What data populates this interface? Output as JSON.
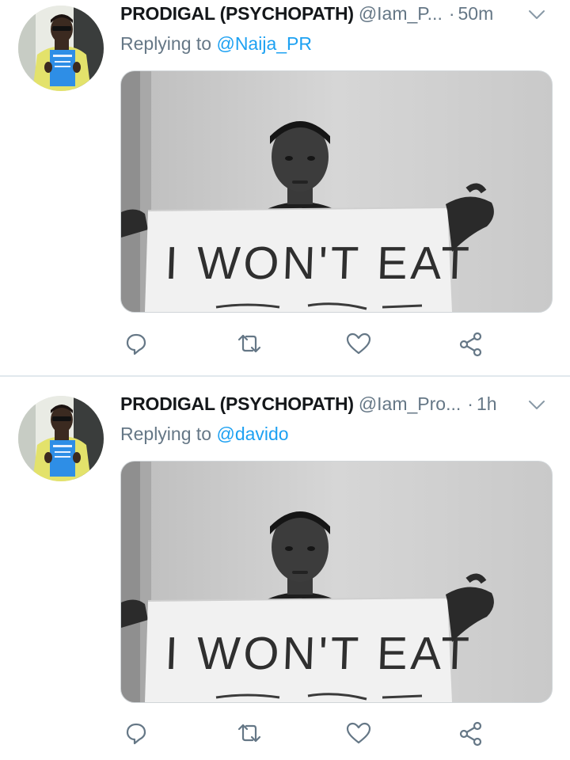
{
  "tweets": [
    {
      "display_name": "PRODIGAL (PSYCHOPATH)",
      "handle": "@Iam_P...",
      "separator": "·",
      "time": "50m",
      "replying_prefix": "Replying to",
      "replying_to": "@Naija_PR",
      "photo_sign_text": "I WON'T EAT"
    },
    {
      "display_name": "PRODIGAL (PSYCHOPATH)",
      "handle": "@Iam_Pro...",
      "separator": "·",
      "time": "1h",
      "replying_prefix": "Replying to",
      "replying_to": "@davido",
      "photo_sign_text": "I WON'T EAT"
    }
  ],
  "action_icons": [
    "reply-icon",
    "retweet-icon",
    "like-icon",
    "share-icon"
  ],
  "colors": {
    "link": "#1da1f2",
    "secondary_text": "#657786",
    "primary_text": "#14171a",
    "divider": "#e1e8ed"
  }
}
